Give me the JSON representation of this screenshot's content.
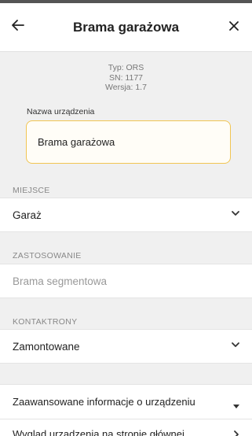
{
  "header": {
    "back_icon": "arrow-left-icon",
    "title": "Brama garażowa",
    "close_icon": "close-icon"
  },
  "device_info": {
    "type": "Typ: ORS",
    "serial": "SN: 1177",
    "version": "Wersja: 1.7"
  },
  "name_field": {
    "label": "Nazwa urządzenia",
    "value": "Brama garażowa",
    "accent_color": "#f1c552"
  },
  "location": {
    "section_label": "MIEJSCE",
    "value": "Garaż",
    "icon": "chevron-down-icon"
  },
  "usage": {
    "section_label": "ZASTOSOWANIE",
    "value": "Brama segmentowa"
  },
  "reed_switches": {
    "section_label": "KONTAKTRONY",
    "value": "Zamontowane",
    "icon": "chevron-down-icon"
  },
  "advanced": {
    "label": "Zaawansowane informacje o urządzeniu",
    "icon": "caret-down-icon"
  },
  "appearance": {
    "label": "Wygląd urządzenia na stronie głównej",
    "icon": "chevron-right-icon"
  }
}
